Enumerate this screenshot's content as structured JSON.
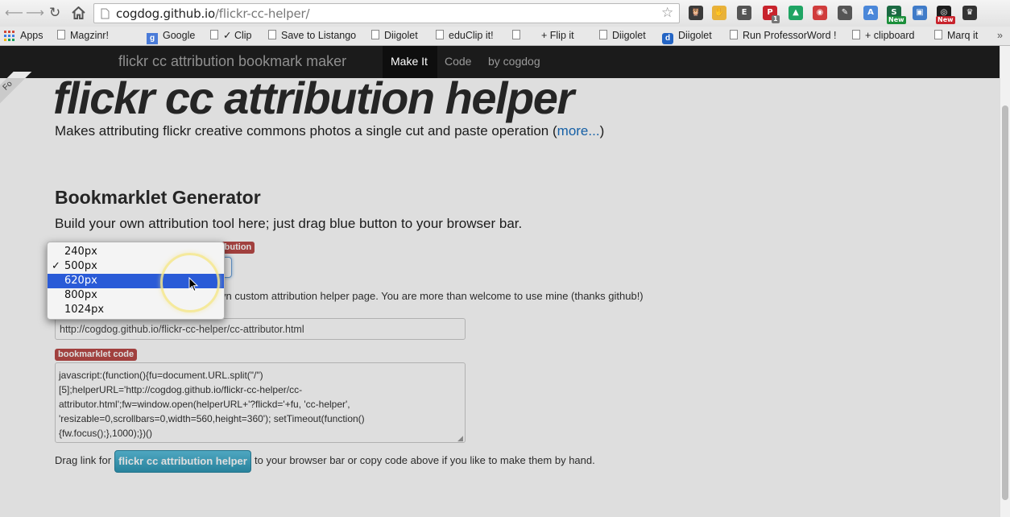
{
  "browser": {
    "url_host": "cogdog.github.io",
    "url_path": "/flickr-cc-helper/",
    "extensions": [
      {
        "name": "owl-extension-icon",
        "glyph": "🦉",
        "color": "#3a3a3a"
      },
      {
        "name": "hand-extension-icon",
        "glyph": "✋",
        "color": "#e8b23a"
      },
      {
        "name": "evernote-icon",
        "glyph": "E",
        "color": "#555"
      },
      {
        "name": "pinterest-icon",
        "glyph": "P",
        "color": "#c8232c"
      },
      {
        "name": "google-drive-icon",
        "glyph": "▲",
        "color": "#1fa463"
      },
      {
        "name": "pocket-icon",
        "glyph": "◉",
        "color": "#d03c3c"
      },
      {
        "name": "tools-icon",
        "glyph": "✎",
        "color": "#555"
      },
      {
        "name": "translate-icon",
        "glyph": "A",
        "color": "#4a87d9"
      },
      {
        "name": "scribd-icon",
        "glyph": "S",
        "color": "#1b6a42"
      },
      {
        "name": "window-icon",
        "glyph": "▣",
        "color": "#3f7bc8"
      },
      {
        "name": "camera-icon",
        "glyph": "◎",
        "color": "#1d1d1d"
      },
      {
        "name": "crown-icon",
        "glyph": "♛",
        "color": "#333"
      }
    ],
    "badge_new_1": "New",
    "badge_new_2": "New",
    "badge_pin_count": "1"
  },
  "bookmarks": [
    "Apps",
    "Magzinr!",
    "Google",
    "✓ Clip",
    "Save to Listango",
    "Diigolet",
    "eduClip it!",
    "+ Flip it",
    "Diigolet",
    "Diigolet",
    "Run ProfessorWord !",
    "+ clipboard",
    "Marq it"
  ],
  "navbar": {
    "brand": "flickr cc attribution bookmark maker",
    "items": [
      "Make It",
      "Code",
      "by cogdog"
    ]
  },
  "ribbon": "Fo",
  "header": {
    "title": "flickr cc attribution helper",
    "lead": "Makes attributing flickr creative commons photos a single cut and paste operation (",
    "more_link": "more...",
    "lead_end": ")"
  },
  "generator": {
    "heading": "Bookmarklet Generator",
    "intro": "Build your own attribution tool here; just drag blue button to your browser bar.",
    "label_size_suffix": "ttribution",
    "size_select_value": "500px",
    "helper_text_visible": "vn custom attribution helper page. You are more than welcome to use mine (thanks github!)",
    "helper_url": "http://cogdog.github.io/flickr-cc-helper/cc-attributor.html",
    "code_label": "bookmarklet code",
    "code": "javascript:(function(){fu=document.URL.split(\"/\")\n[5];helperURL='http://cogdog.github.io/flickr-cc-helper/cc-\nattributor.html';fw=window.open(helperURL+'?flickd='+fu, 'cc-helper',\n'resizable=0,scrollbars=0,width=560,height=360'); setTimeout(function()\n{fw.focus();},1000);})()",
    "drag_prefix": "Drag link for",
    "button_label": "flickr cc attribution helper",
    "drag_suffix": "to your browser bar or copy code above if you like to make them by hand."
  },
  "dropdown": {
    "options": [
      "240px",
      "500px",
      "620px",
      "800px",
      "1024px"
    ],
    "checked": "500px",
    "highlighted": "620px",
    "checkmark": "✓"
  }
}
